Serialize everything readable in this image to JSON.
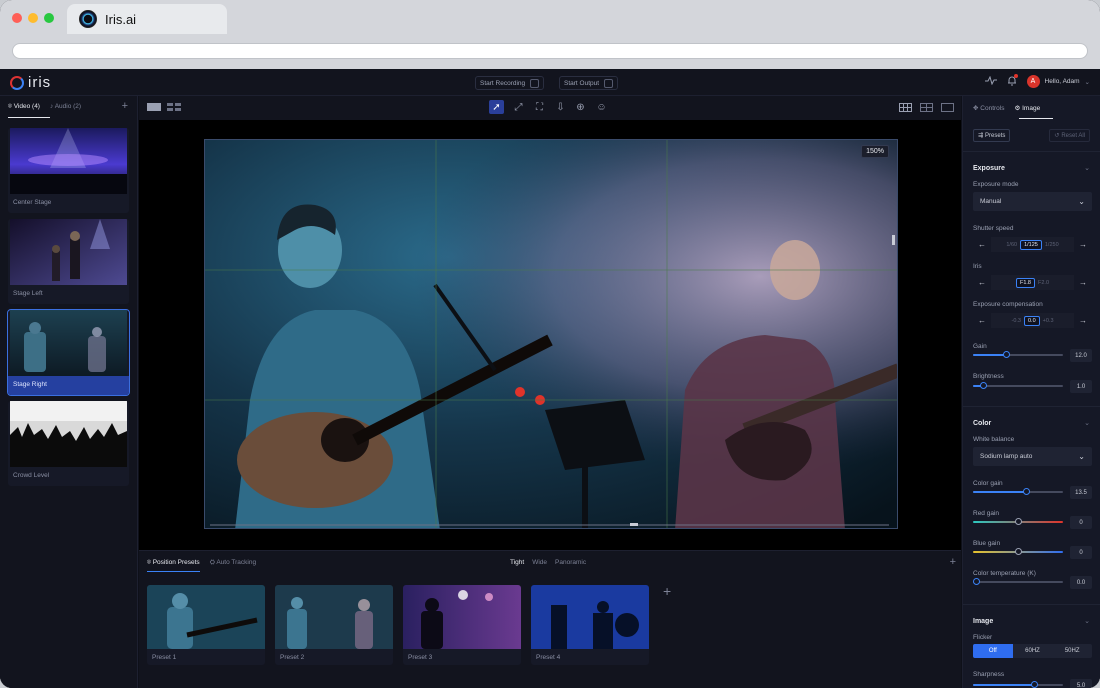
{
  "browser": {
    "tab_title": "Iris.ai"
  },
  "app": {
    "logo": "iris",
    "start_recording": "Start Recording",
    "start_output": "Start Output",
    "greeting": "Hello, Adam",
    "avatar_initial": "A"
  },
  "left": {
    "tab_video": "Video (4)",
    "tab_audio": "Audio (2)",
    "cameras": [
      {
        "label": "Center Stage"
      },
      {
        "label": "Stage Left"
      },
      {
        "label": "Stage Right"
      },
      {
        "label": "Crowd Level"
      }
    ]
  },
  "viewer": {
    "zoom": "150%"
  },
  "presets": {
    "tab_position": "Position Presets",
    "tab_auto": "Auto Tracking",
    "mode_tight": "Tight",
    "mode_wide": "Wide",
    "mode_panoramic": "Panoramic",
    "items": [
      {
        "label": "Preset 1"
      },
      {
        "label": "Preset 2"
      },
      {
        "label": "Preset 3"
      },
      {
        "label": "Preset 4"
      }
    ]
  },
  "right": {
    "tab_controls": "Controls",
    "tab_image": "Image",
    "presets_btn": "Presets",
    "reset_btn": "Reset All",
    "exposure": {
      "title": "Exposure",
      "mode_label": "Exposure mode",
      "mode_value": "Manual",
      "shutter_label": "Shutter speed",
      "shutter_prev": "1/60",
      "shutter_value": "1/125",
      "shutter_next": "1/250",
      "iris_label": "Iris",
      "iris_value": "F1.8",
      "iris_next": "F2.0",
      "comp_label": "Exposure compensation",
      "comp_prev": "-0.3",
      "comp_value": "0.0",
      "comp_next": "+0.3",
      "gain_label": "Gain",
      "gain_value": "12.0",
      "gain_fraction": 0.37,
      "brightness_label": "Brightness",
      "brightness_value": "1.0",
      "brightness_fraction": 0.12
    },
    "color": {
      "title": "Color",
      "wb_label": "White balance",
      "wb_value": "Sodium lamp auto",
      "color_gain_label": "Color gain",
      "color_gain_value": "13.5",
      "color_gain_fraction": 0.59,
      "red_gain_label": "Red gain",
      "red_gain_value": "0",
      "red_gain_fraction": 0.5,
      "blue_gain_label": "Blue gain",
      "blue_gain_value": "0",
      "blue_gain_fraction": 0.5,
      "temp_label": "Color temperature (K)",
      "temp_value": "0.0",
      "temp_fraction": 0.04
    },
    "image": {
      "title": "Image",
      "flicker_label": "Flicker",
      "flicker_off": "Off",
      "flicker_60": "60HZ",
      "flicker_50": "50HZ",
      "sharpness_label": "Sharpness",
      "sharpness_value": "5.0",
      "sharpness_fraction": 0.68
    }
  },
  "colors": {
    "accent": "#3b82f6",
    "selected": "#2540a0",
    "red": "#e0332a"
  }
}
